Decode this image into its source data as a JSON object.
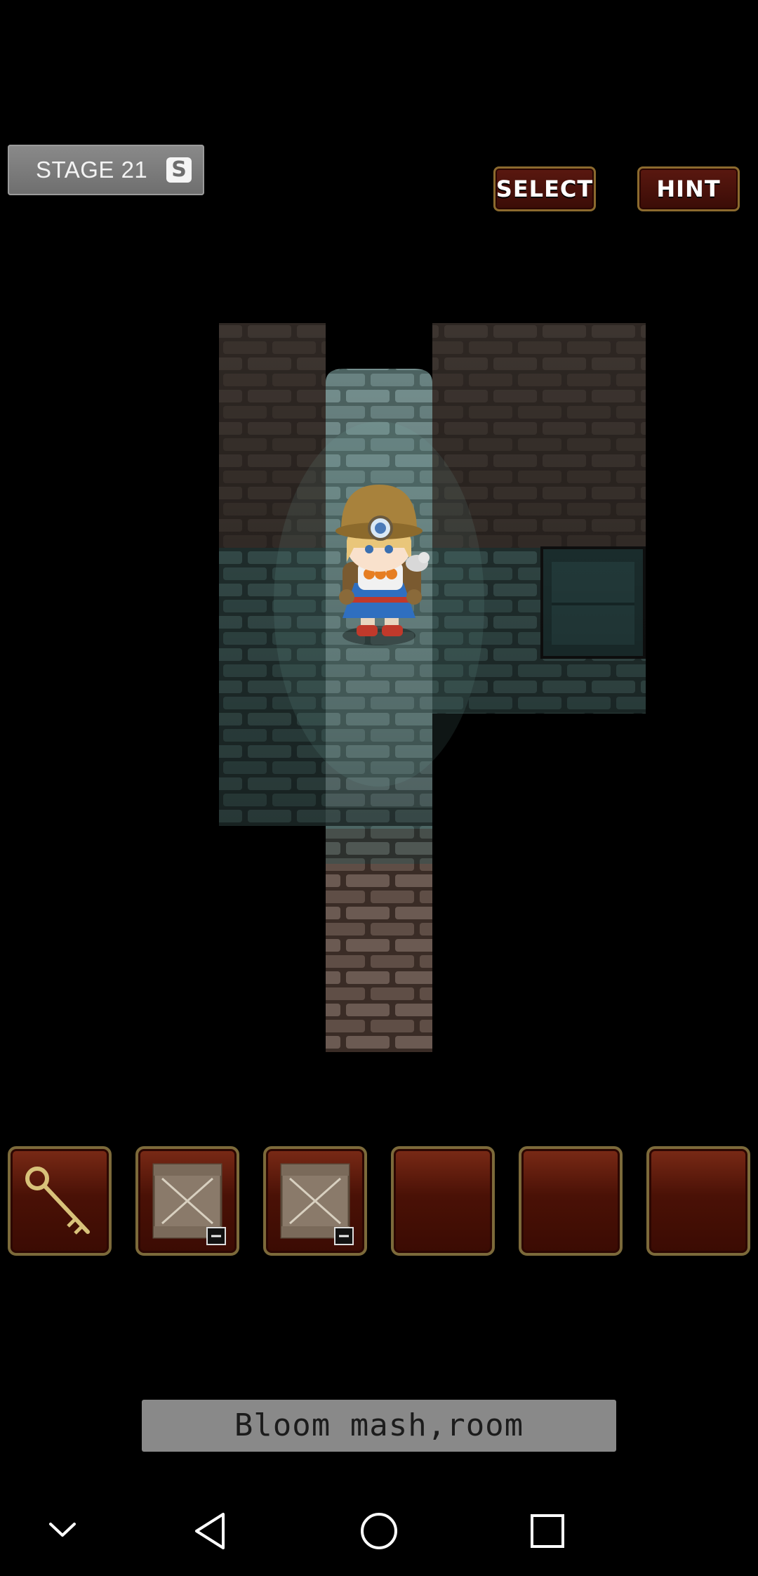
{
  "header": {
    "stage_label": "STAGE 21",
    "save_icon_glyph": "S",
    "select_label": "SELECT",
    "hint_label": "HINT"
  },
  "inventory": {
    "slots": [
      {
        "item": "key-icon"
      },
      {
        "item": "wooden-crate-icon"
      },
      {
        "item": "wooden-crate-icon"
      },
      {
        "item": "empty"
      },
      {
        "item": "empty"
      },
      {
        "item": "empty"
      }
    ]
  },
  "location": {
    "name": "Bloom mash,room"
  },
  "system_nav": {
    "items": [
      "chevron-down-icon",
      "back-icon",
      "home-icon",
      "recents-icon"
    ]
  }
}
